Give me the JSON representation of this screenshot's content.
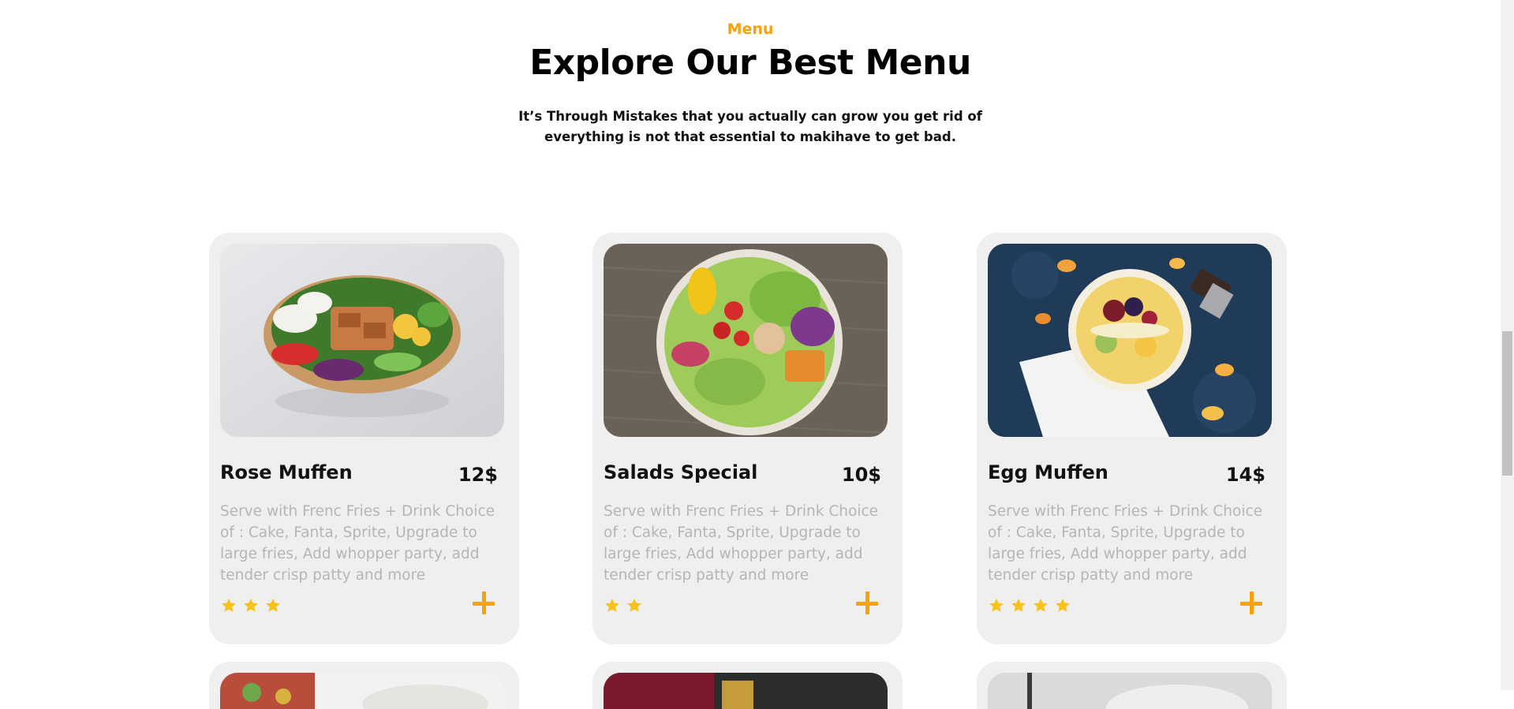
{
  "header": {
    "eyebrow": "Menu",
    "title": "Explore Our Best Menu",
    "subtitle": "It’s Through Mistakes that you actually can grow you get rid of everything is not that essential to makihave to get bad."
  },
  "colors": {
    "accent": "#f7a20b",
    "star": "#f9c21a",
    "card_bg": "#efefef",
    "desc_text": "#b5b5b5"
  },
  "menu_items": [
    {
      "name": "Rose Muffen",
      "price": "12$",
      "description": "Serve with Frenc Fries + Drink Choice of : Cake, Fanta, Sprite, Upgrade to large fries, Add whopper party, add tender crisp patty and more",
      "rating": 3,
      "icon": "plus-icon"
    },
    {
      "name": "Salads Special",
      "price": "10$",
      "description": "Serve with Frenc Fries + Drink Choice of : Cake, Fanta, Sprite, Upgrade to large fries, Add whopper party, add tender crisp patty and more",
      "rating": 2,
      "icon": "plus-icon"
    },
    {
      "name": "Egg Muffen",
      "price": "14$",
      "description": "Serve with Frenc Fries + Drink Choice of : Cake, Fanta, Sprite, Upgrade to large fries, Add whopper party, add tender crisp patty and more",
      "rating": 4,
      "icon": "plus-icon"
    }
  ]
}
